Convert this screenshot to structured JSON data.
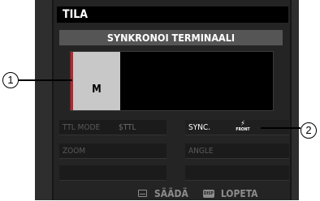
{
  "screen": {
    "title": "TILA",
    "subtitle": "SYNKRONOI TERMINAALI"
  },
  "mode": {
    "value": "M"
  },
  "fields": {
    "ttl_mode": {
      "label": "TTL MODE",
      "value": "$TTL"
    },
    "zoom": {
      "label": "ZOOM"
    },
    "sync": {
      "label": "SYNC.",
      "icon_caption": "FRONT",
      "icon": "flash-front-curtain-icon"
    },
    "angle": {
      "label": "ANGLE"
    }
  },
  "footer": {
    "adjust_label": "SÄÄDÄ",
    "adjust_icon": "menu-ok-icon",
    "disp_icon_caption": "DISP",
    "exit_label": "LOPETA"
  },
  "callouts": {
    "one": "1",
    "two": "2"
  },
  "colors": {
    "accent": "#c0202c",
    "screen_bg": "#242424",
    "title_bg": "#000000"
  }
}
